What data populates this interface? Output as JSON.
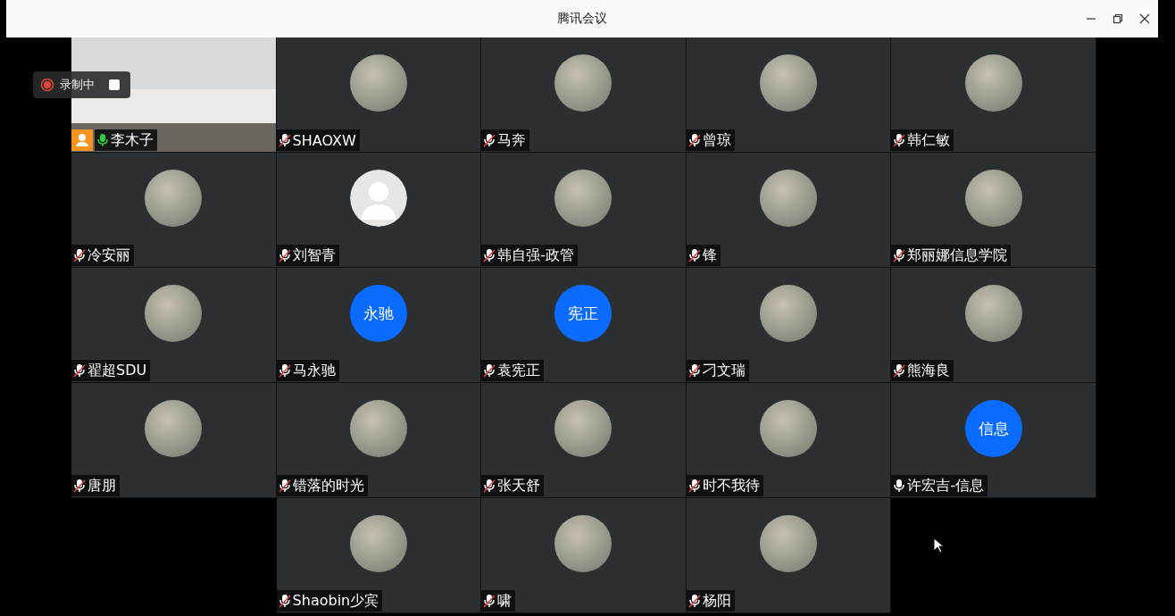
{
  "window": {
    "title": "腾讯会议"
  },
  "recording": {
    "label": "录制中"
  },
  "participants": [
    {
      "name": "李木子",
      "muted": false,
      "speaking": true,
      "host": true,
      "kind": "video"
    },
    {
      "name": "SHAOXW",
      "muted": true,
      "speaking": false,
      "host": false,
      "kind": "photo"
    },
    {
      "name": "马奔",
      "muted": true,
      "speaking": false,
      "host": false,
      "kind": "photo"
    },
    {
      "name": "曾琼",
      "muted": true,
      "speaking": false,
      "host": false,
      "kind": "photo"
    },
    {
      "name": "韩仁敏",
      "muted": true,
      "speaking": false,
      "host": false,
      "kind": "photo"
    },
    {
      "name": "冷安丽",
      "muted": true,
      "speaking": false,
      "host": false,
      "kind": "photo"
    },
    {
      "name": "刘智青",
      "muted": true,
      "speaking": false,
      "host": false,
      "kind": "default"
    },
    {
      "name": "韩自强-政管",
      "muted": true,
      "speaking": false,
      "host": false,
      "kind": "photo"
    },
    {
      "name": "锋",
      "muted": true,
      "speaking": false,
      "host": false,
      "kind": "photo"
    },
    {
      "name": "郑丽娜信息学院",
      "muted": true,
      "speaking": false,
      "host": false,
      "kind": "photo"
    },
    {
      "name": "翟超SDU",
      "muted": true,
      "speaking": false,
      "host": false,
      "kind": "photo"
    },
    {
      "name": "马永驰",
      "muted": true,
      "speaking": false,
      "host": false,
      "kind": "initials",
      "avatar_text": "永驰"
    },
    {
      "name": "袁宪正",
      "muted": true,
      "speaking": false,
      "host": false,
      "kind": "initials",
      "avatar_text": "宪正"
    },
    {
      "name": "刁文瑞",
      "muted": true,
      "speaking": false,
      "host": false,
      "kind": "photo"
    },
    {
      "name": "熊海良",
      "muted": true,
      "speaking": false,
      "host": false,
      "kind": "photo"
    },
    {
      "name": "唐朋",
      "muted": true,
      "speaking": false,
      "host": false,
      "kind": "photo"
    },
    {
      "name": "错落的时光",
      "muted": true,
      "speaking": false,
      "host": false,
      "kind": "photo"
    },
    {
      "name": "张天舒",
      "muted": true,
      "speaking": false,
      "host": false,
      "kind": "photo"
    },
    {
      "name": "时不我待",
      "muted": true,
      "speaking": false,
      "host": false,
      "kind": "photo"
    },
    {
      "name": "许宏吉-信息",
      "muted": false,
      "speaking": false,
      "host": false,
      "kind": "initials",
      "avatar_text": "信息"
    },
    {
      "name": "Shaobin少宾",
      "muted": true,
      "speaking": false,
      "host": false,
      "kind": "photo"
    },
    {
      "name": "啸",
      "muted": true,
      "speaking": false,
      "host": false,
      "kind": "photo"
    },
    {
      "name": "杨阳",
      "muted": true,
      "speaking": false,
      "host": false,
      "kind": "photo"
    }
  ]
}
